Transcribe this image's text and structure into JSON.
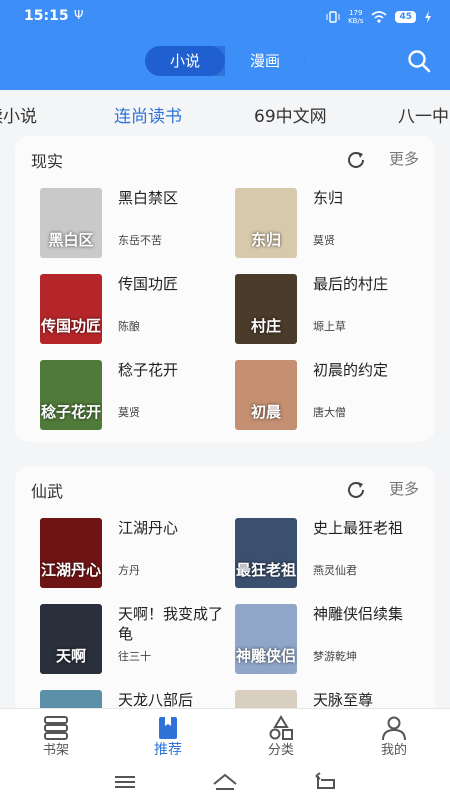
{
  "status": {
    "time": "15:15",
    "usb": "Ψ",
    "net_speed_value": "179",
    "net_speed_unit": "KB/s",
    "battery": "45"
  },
  "header": {
    "tabs": [
      {
        "label": "小说"
      },
      {
        "label": "漫画"
      }
    ]
  },
  "sources": [
    "读小说",
    "连尚读书",
    "69中文网",
    "八一中"
  ],
  "sections": [
    {
      "title": "现实",
      "more": "更多",
      "books": [
        {
          "title": "黑白禁区",
          "author": "东岳不苦",
          "cover_text": "黑白区",
          "cover_color": "#c9c9c9"
        },
        {
          "title": "东归",
          "author": "莫贤",
          "cover_text": "东归",
          "cover_color": "#d7c9ab"
        },
        {
          "title": "传国功匠",
          "author": "陈酿",
          "cover_text": "传国功匠",
          "cover_color": "#b5262a"
        },
        {
          "title": "最后的村庄",
          "author": "塬上草",
          "cover_text": "村庄",
          "cover_color": "#4a3b2a"
        },
        {
          "title": "稔子花开",
          "author": "莫贤",
          "cover_text": "稔子花开",
          "cover_color": "#4f7a3a"
        },
        {
          "title": "初晨的约定",
          "author": "唐大僧",
          "cover_text": "初晨",
          "cover_color": "#c58f72"
        }
      ]
    },
    {
      "title": "仙武",
      "more": "更多",
      "books": [
        {
          "title": "江湖丹心",
          "author": "方丹",
          "cover_text": "江湖丹心",
          "cover_color": "#6e1414"
        },
        {
          "title": "史上最狂老祖",
          "author": "燕灵仙君",
          "cover_text": "最狂老祖",
          "cover_color": "#3b4f6e"
        },
        {
          "title": "天啊！我变成了龟",
          "author": "往三十",
          "cover_text": "天啊",
          "cover_color": "#2a2f3c"
        },
        {
          "title": "神雕侠侣续集",
          "author": "梦游乾坤",
          "cover_text": "神雕侠侣",
          "cover_color": "#8fa6c9"
        },
        {
          "title": "天龙八部后",
          "author": "",
          "cover_text": "",
          "cover_color": "#5c8fa8"
        },
        {
          "title": "天脉至尊",
          "author": "",
          "cover_text": "",
          "cover_color": "#d8cfc0"
        }
      ]
    }
  ],
  "bottom_nav": [
    {
      "label": "书架",
      "icon": "bookshelf-icon"
    },
    {
      "label": "推荐",
      "icon": "recommend-icon"
    },
    {
      "label": "分类",
      "icon": "category-icon"
    },
    {
      "label": "我的",
      "icon": "profile-icon"
    }
  ],
  "colors": {
    "accent": "#3d8ff7",
    "active_text": "#2f73d8"
  }
}
